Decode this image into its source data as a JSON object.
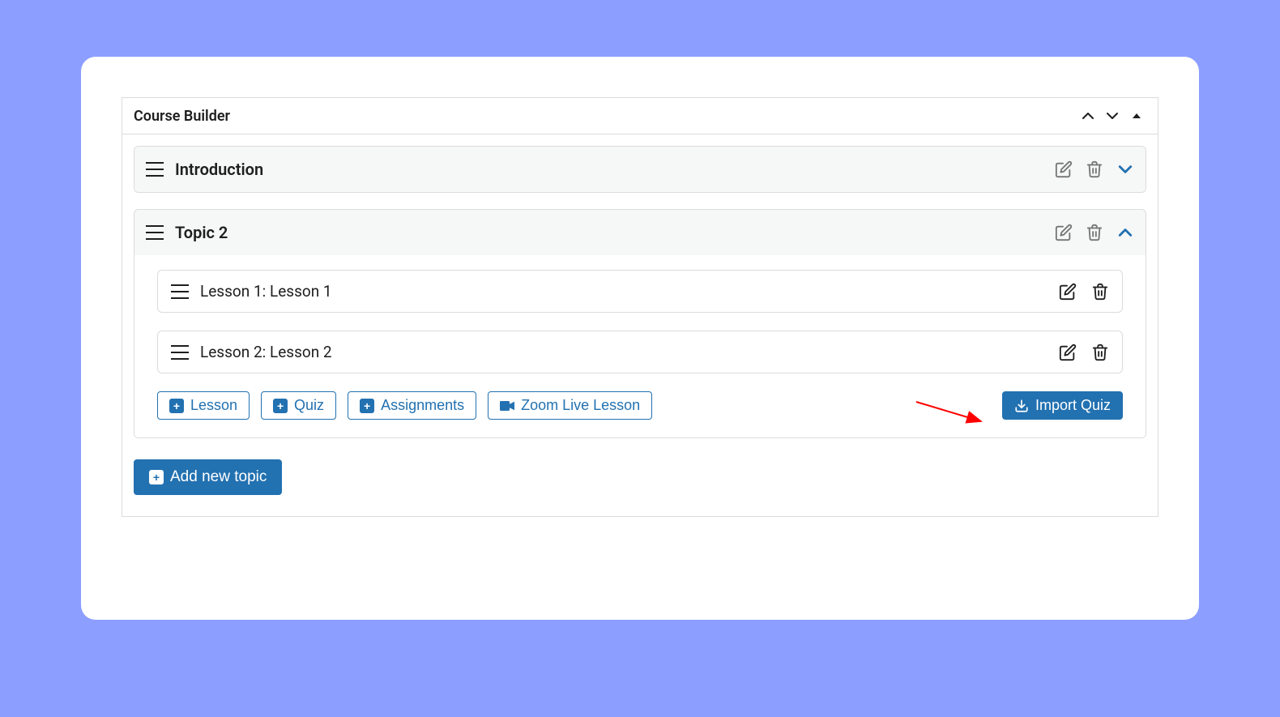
{
  "colors": {
    "accent": "#2271b1",
    "arrow": "#ff0000"
  },
  "panel_title": "Course Builder",
  "topics": [
    {
      "title": "Introduction",
      "expanded": false,
      "lessons": []
    },
    {
      "title": "Topic 2",
      "expanded": true,
      "lessons": [
        {
          "label": "Lesson 1: Lesson 1"
        },
        {
          "label": "Lesson 2: Lesson 2"
        }
      ]
    }
  ],
  "content_buttons": {
    "lesson": "Lesson",
    "quiz": "Quiz",
    "assignments": "Assignments",
    "zoom": "Zoom Live Lesson",
    "import_quiz": "Import Quiz"
  },
  "add_topic_label": "Add new topic"
}
